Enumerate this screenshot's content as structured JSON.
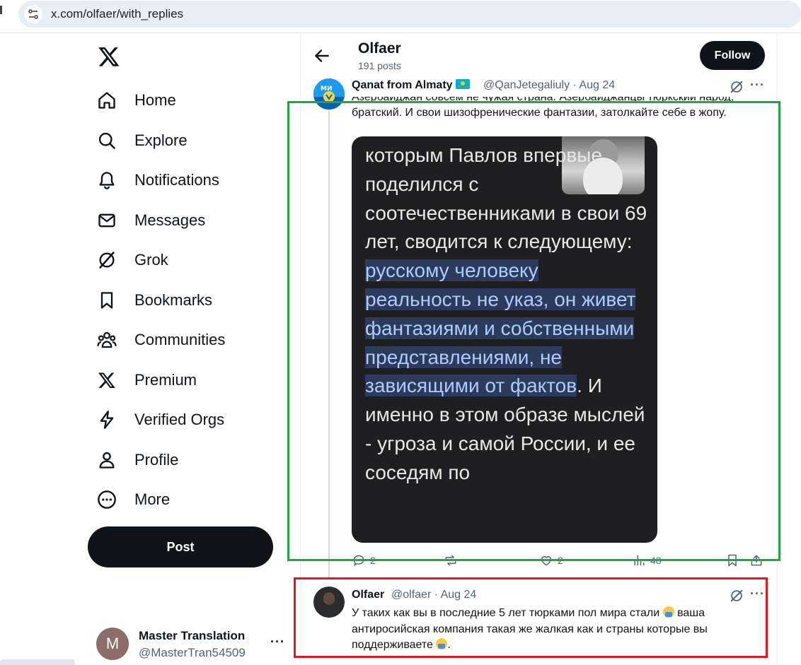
{
  "browser": {
    "url": "x.com/olfaer/with_replies"
  },
  "nav": {
    "items": [
      {
        "label": "Home",
        "icon": "home-icon"
      },
      {
        "label": "Explore",
        "icon": "search-icon"
      },
      {
        "label": "Notifications",
        "icon": "bell-icon"
      },
      {
        "label": "Messages",
        "icon": "mail-icon"
      },
      {
        "label": "Grok",
        "icon": "grok-icon"
      },
      {
        "label": "Bookmarks",
        "icon": "bookmark-icon"
      },
      {
        "label": "Communities",
        "icon": "people-icon"
      },
      {
        "label": "Premium",
        "icon": "x-logo-icon"
      },
      {
        "label": "Verified Orgs",
        "icon": "lightning-icon"
      },
      {
        "label": "Profile",
        "icon": "person-icon"
      },
      {
        "label": "More",
        "icon": "more-circle-icon"
      }
    ],
    "post_label": "Post"
  },
  "account": {
    "initial": "M",
    "name": "Master Translation",
    "handle": "@MasterTran54509",
    "more": "···"
  },
  "profile": {
    "name": "Olfaer",
    "posts": "191 posts",
    "follow_label": "Follow"
  },
  "tweets": [
    {
      "name": "Qanat from Almaty",
      "handle": "@QanJetegaliuly",
      "date": "Aug 24",
      "meta": "@QanJetegaliuly · Aug 24",
      "text_line1": "Азербайджан совсем не чужая страна. Азербайджанцы тюркский народ,",
      "text_line2": "братский. И свои шизофренические фантазии, затолкайте себе в жопу.",
      "image_text_plain": "которым Павлов впервые поделился с соотечественниками в свои 69 лет, сводится к следующему: ",
      "image_text_highlight": "русскому человеку реальность не указ, он живет фантазиями и собственными представлениями, не зависящими от фактов",
      "image_text_tail": ". И именно в этом образе мыслей - угроза и самой России, и ее соседям по",
      "actions": {
        "replies": "2",
        "reposts": "",
        "likes": "2",
        "views": "48"
      }
    },
    {
      "name": "Olfaer",
      "handle": "@olfaer",
      "date": "Aug 24",
      "meta": "@olfaer · Aug 24",
      "text_part1": "У таких как вы в последние 5 лет тюрками пол мира стали ",
      "text_part2": " ваша антиросийская компания такая же жалкая как и страны которые вы поддерживаете ",
      "text_part3": "."
    }
  ],
  "colors": {
    "accent": "#0f1419",
    "highlight_box_1": "#22a645",
    "highlight_box_2": "#e0171d",
    "muted": "#536471"
  }
}
